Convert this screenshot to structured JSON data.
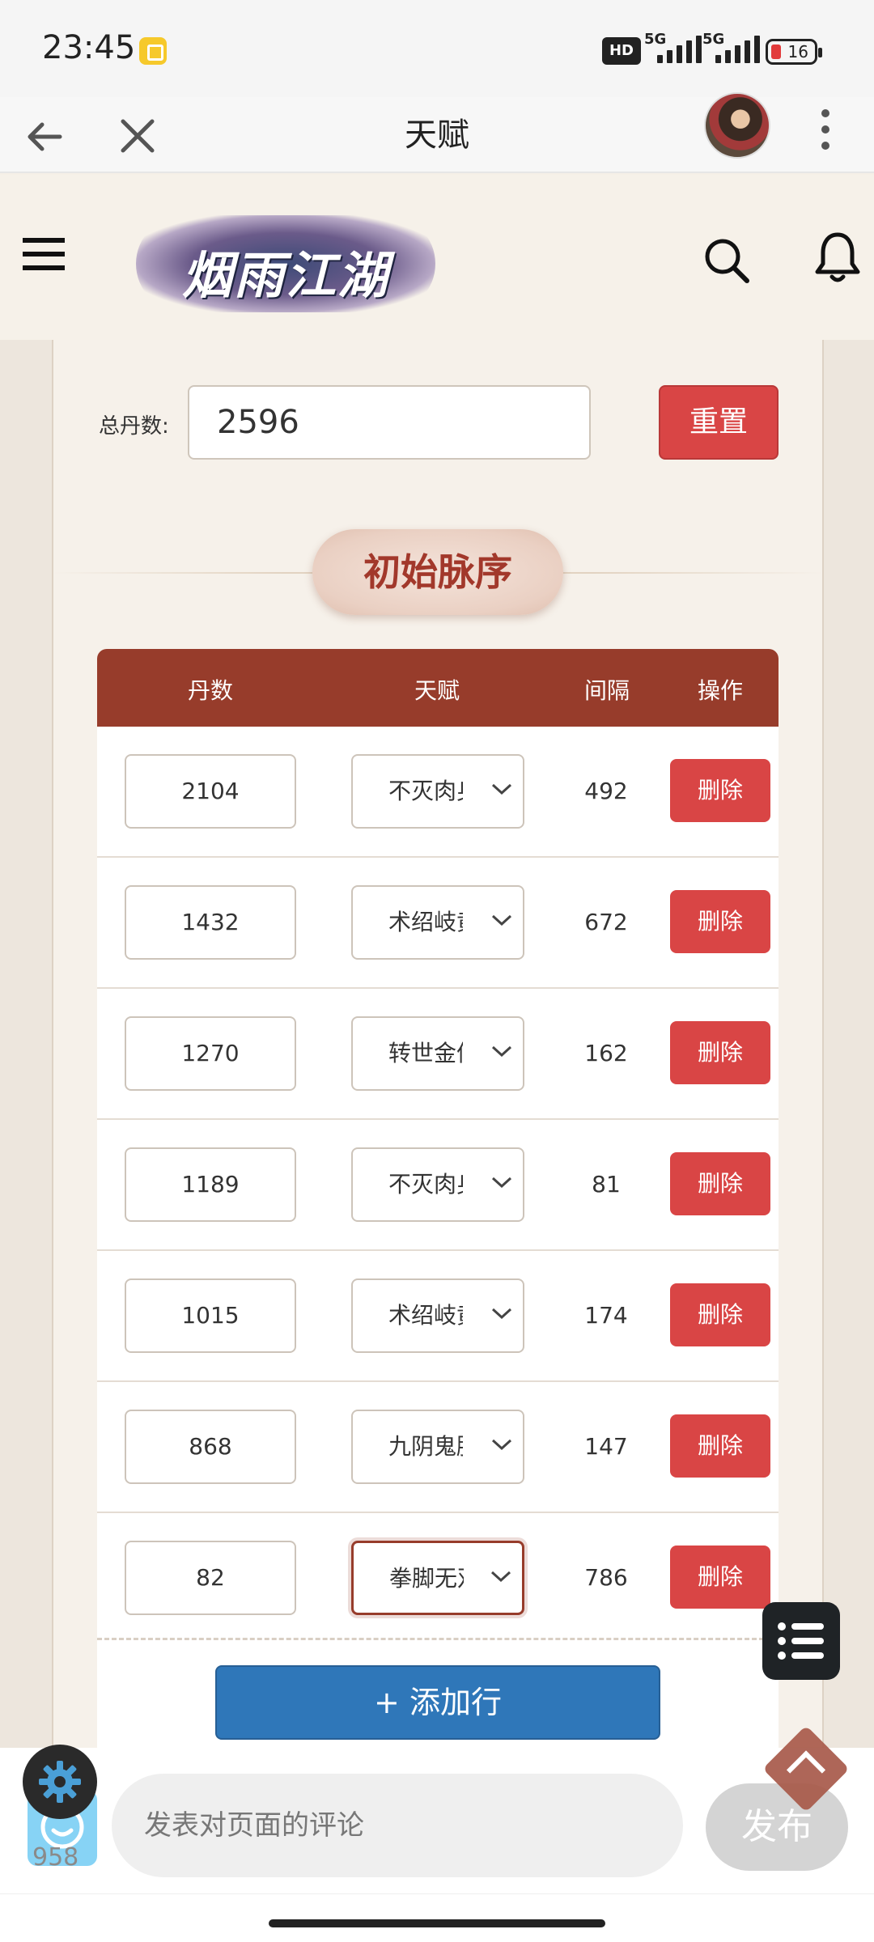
{
  "status_bar": {
    "time": "23:45",
    "network_hd": "HD",
    "network_5g_1": "5G",
    "network_5g_2": "5G",
    "battery": "16"
  },
  "app_bar": {
    "title": "天赋"
  },
  "site": {
    "logo_text": "烟雨江湖"
  },
  "form": {
    "total_label": "总丹数:",
    "total_value": "2596",
    "reset_label": "重置"
  },
  "section": {
    "title": "初始脉序"
  },
  "table": {
    "headers": {
      "dan": "丹数",
      "talent": "天赋",
      "interval": "间隔",
      "action": "操作"
    },
    "rows": [
      {
        "dan": "2104",
        "talent": "不灭肉身",
        "interval": "492",
        "action": "删除"
      },
      {
        "dan": "1432",
        "talent": "术绍岐黄",
        "interval": "672",
        "action": "删除"
      },
      {
        "dan": "1270",
        "talent": "转世金仙",
        "interval": "162",
        "action": "删除"
      },
      {
        "dan": "1189",
        "talent": "不灭肉身",
        "interval": "81",
        "action": "删除"
      },
      {
        "dan": "1015",
        "talent": "术绍岐黄",
        "interval": "174",
        "action": "删除"
      },
      {
        "dan": "868",
        "talent": "九阴鬼脉",
        "interval": "147",
        "action": "删除"
      },
      {
        "dan": "82",
        "talent": "拳脚无双",
        "interval": "786",
        "action": "删除"
      }
    ],
    "add_row_label": "+ 添加行"
  },
  "comment": {
    "placeholder": "发表对页面的评论",
    "publish_label": "发布",
    "like_count": "958"
  },
  "colors": {
    "brand_dark_red": "#973c2b",
    "danger": "#d94545",
    "primary_blue": "#2f77b9",
    "page_bg": "#f6f1ea"
  },
  "icons": [
    "back-icon",
    "close-icon",
    "more-icon",
    "menu-icon",
    "search-icon",
    "bell-icon",
    "chevron-down-icon",
    "list-icon",
    "gear-icon",
    "chevron-up-icon",
    "smile-icon"
  ]
}
